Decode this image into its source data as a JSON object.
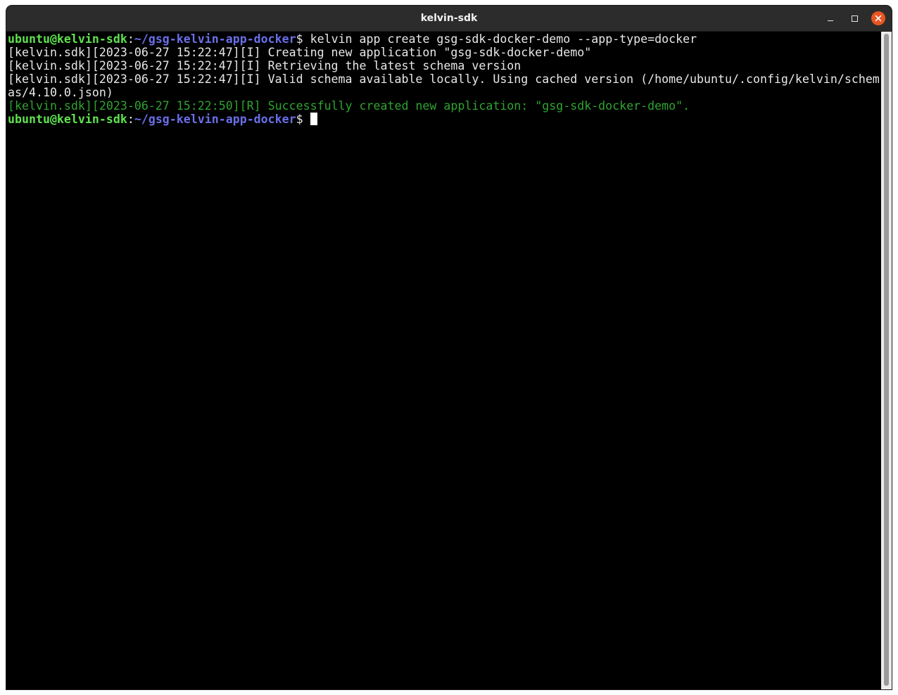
{
  "window": {
    "title": "kelvin-sdk"
  },
  "terminal": {
    "prompt": {
      "user_host": "ubuntu@kelvin-sdk",
      "separator": ":",
      "path": "~/gsg-kelvin-app-docker",
      "symbol": "$ "
    },
    "command": "kelvin app create gsg-sdk-docker-demo --app-type=docker",
    "output": [
      "[kelvin.sdk][2023-06-27 15:22:47][I] Creating new application \"gsg-sdk-docker-demo\"",
      "[kelvin.sdk][2023-06-27 15:22:47][I] Retrieving the latest schema version",
      "[kelvin.sdk][2023-06-27 15:22:47][I] Valid schema available locally. Using cached version (/home/ubuntu/.config/kelvin/schem",
      "as/4.10.0.json)"
    ],
    "success_line": "[kelvin.sdk][2023-06-27 15:22:50][R] Successfully created new application: \"gsg-sdk-docker-demo\".",
    "colors": {
      "background": "#000000",
      "prompt_user": "#5fe14f",
      "prompt_path": "#6a6fe8",
      "success": "#2fa42f",
      "text": "#e8e8e8",
      "close_button": "#e95420"
    }
  },
  "icons": {
    "minimize": "minimize-icon",
    "maximize": "maximize-icon",
    "close": "close-icon"
  }
}
